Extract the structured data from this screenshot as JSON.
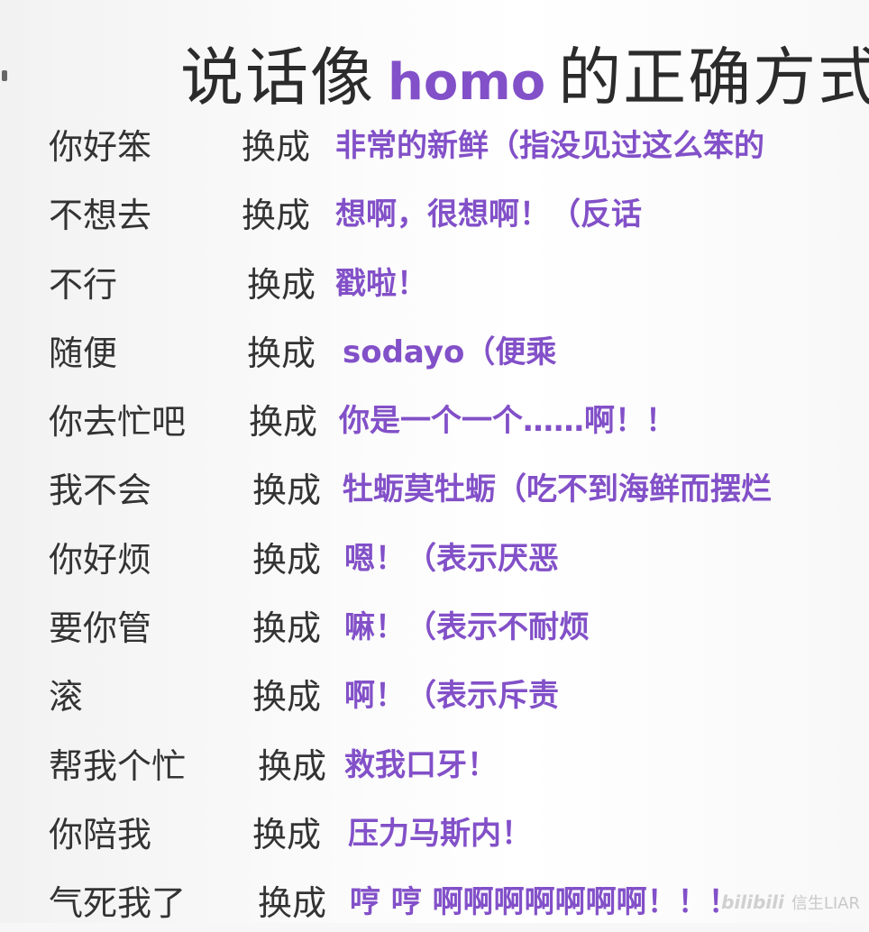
{
  "title": {
    "left": "说话像",
    "accent": "homo",
    "right": "的正确方式"
  },
  "rows": [
    {
      "phrase": "你好笨",
      "verb": "换成",
      "replacement": "非常的新鲜（指没见过这么笨的"
    },
    {
      "phrase": "不想去",
      "verb": "换成",
      "replacement": "想啊，很想啊！（反话"
    },
    {
      "phrase": "不行",
      "verb": "换成",
      "replacement": "戳啦！"
    },
    {
      "phrase": "随便",
      "verb": "换成",
      "replacement": "sodayo（便乘"
    },
    {
      "phrase": "你去忙吧",
      "verb": "换成",
      "replacement": "你是一个一个……啊！！"
    },
    {
      "phrase": "我不会",
      "verb": "换成",
      "replacement": "牡蛎莫牡蛎（吃不到海鲜而摆烂"
    },
    {
      "phrase": "你好烦",
      "verb": "换成",
      "replacement": "嗯！（表示厌恶"
    },
    {
      "phrase": "要你管",
      "verb": "换成",
      "replacement": "嘛！（表示不耐烦"
    },
    {
      "phrase": "滚",
      "verb": "换成",
      "replacement": "啊！（表示斥责"
    },
    {
      "phrase": "帮我个忙",
      "verb": "换成",
      "replacement": "救我口牙！"
    },
    {
      "phrase": "你陪我",
      "verb": "换成",
      "replacement": "压力马斯内！"
    },
    {
      "phrase": "气死我了",
      "verb": "换成",
      "replacement": "哼 哼 啊啊啊啊啊啊啊！！！"
    }
  ],
  "watermark": {
    "logo": "bilibili",
    "author": "信生LIAR"
  },
  "colors": {
    "accent": "#8250c8",
    "text": "#333333"
  }
}
